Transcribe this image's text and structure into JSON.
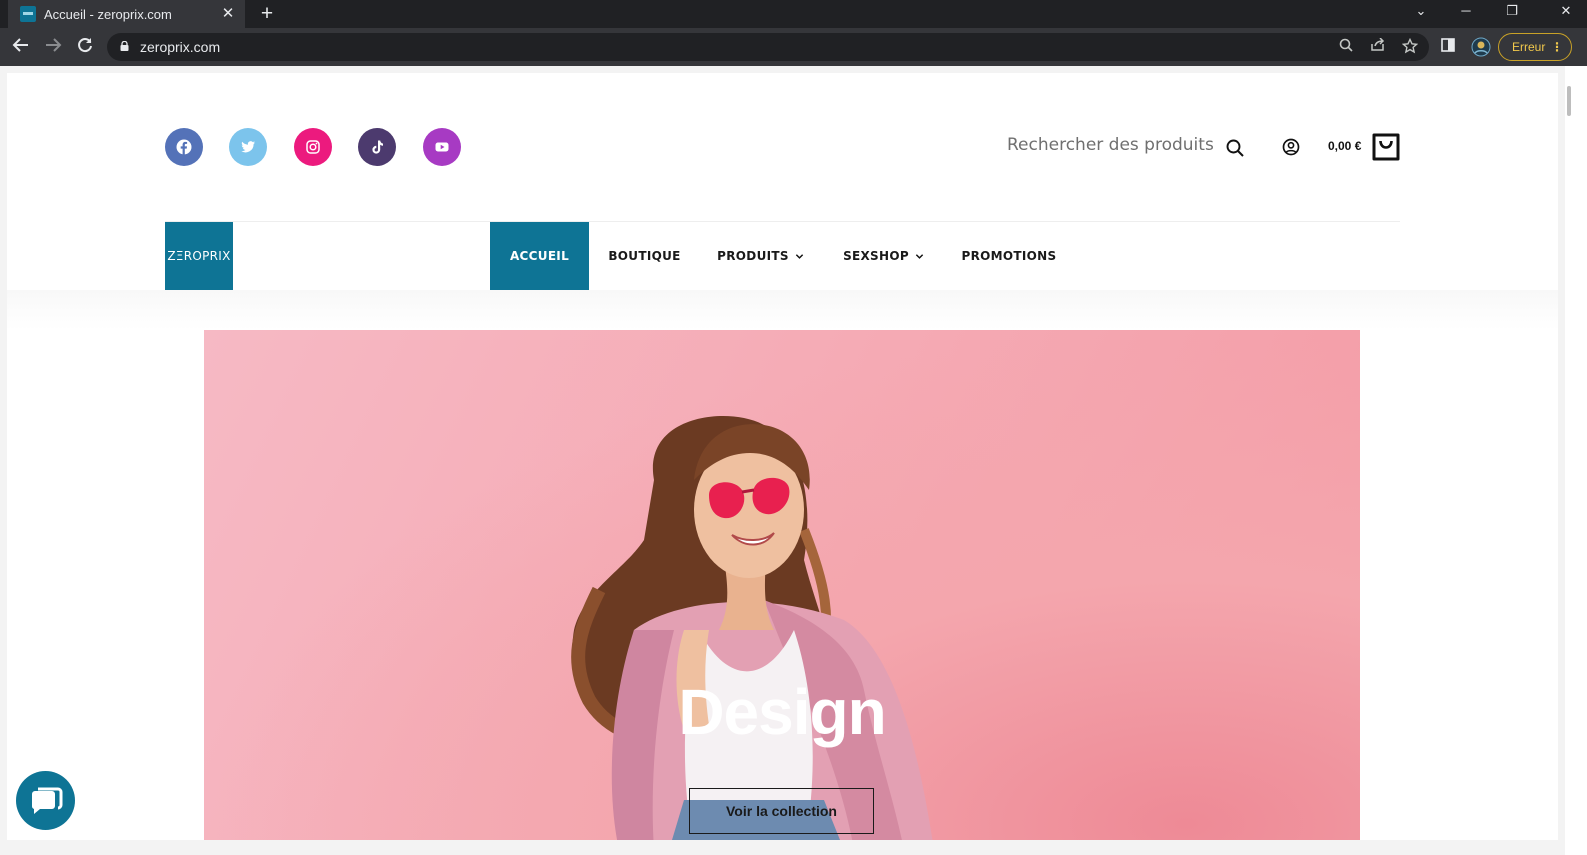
{
  "browser": {
    "tab_title": "Accueil - zeroprix.com",
    "url": "zeroprix.com",
    "profile_status": "Erreur"
  },
  "header": {
    "social": [
      {
        "name": "facebook",
        "color": "#5472b8"
      },
      {
        "name": "twitter",
        "color": "#7cc4ec"
      },
      {
        "name": "instagram",
        "color": "#ec1a7e"
      },
      {
        "name": "tiktok",
        "color": "#4c3a6e"
      },
      {
        "name": "youtube",
        "color": "#a73ac3"
      }
    ],
    "search_placeholder": "Rechercher des produits",
    "cart_total": "0,00 €"
  },
  "logo": {
    "text": "ZΞROPRIX",
    "color": "#0e7495"
  },
  "menu": {
    "items": [
      {
        "label": "ACCUEIL",
        "active": true
      },
      {
        "label": "BOUTIQUE"
      },
      {
        "label": "PRODUITS",
        "dropdown": true
      },
      {
        "label": "SEXSHOP",
        "dropdown": true
      },
      {
        "label": "PROMOTIONS"
      }
    ]
  },
  "hero": {
    "title": "Design",
    "button_label": "Voir la collection"
  },
  "colors": {
    "accent": "#0e7495",
    "hero_pink": "#f5aab4"
  }
}
